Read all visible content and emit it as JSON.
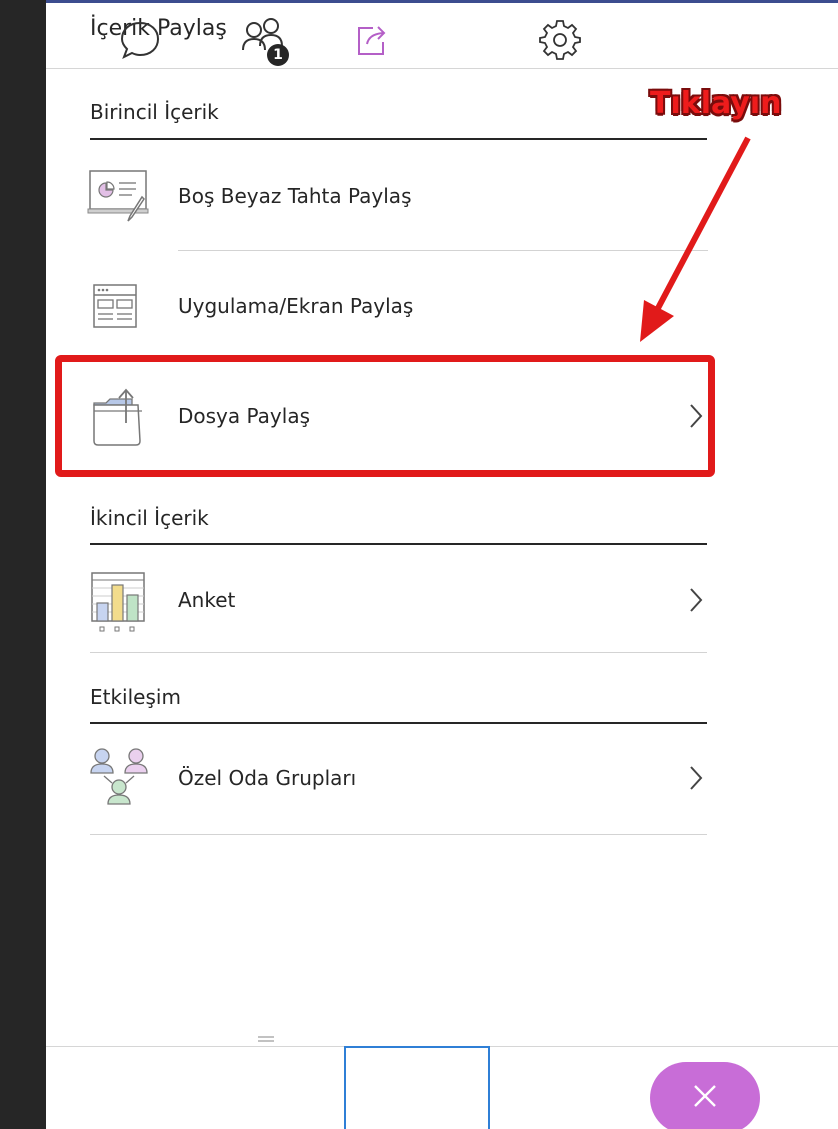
{
  "panel": {
    "title": "İçerik Paylaş"
  },
  "sections": {
    "primary": {
      "header": "Birincil İçerik",
      "items": [
        {
          "label": "Boş Beyaz Tahta Paylaş",
          "icon": "whiteboard-icon"
        },
        {
          "label": "Uygulama/Ekran Paylaş",
          "icon": "application-screen-icon"
        },
        {
          "label": "Dosya Paylaş",
          "icon": "file-share-folder-icon"
        }
      ]
    },
    "secondary": {
      "header": "İkincil İçerik",
      "items": [
        {
          "label": "Anket",
          "icon": "poll-chart-icon"
        }
      ]
    },
    "interaction": {
      "header": "Etkileşim",
      "items": [
        {
          "label": "Özel Oda Grupları",
          "icon": "breakout-groups-icon"
        }
      ]
    }
  },
  "annotation": {
    "text": "Tıklayın",
    "color": "#ee1c1c"
  },
  "bottom_tabs": {
    "chat": {
      "icon": "chat-bubble-icon"
    },
    "attendees": {
      "icon": "attendees-icon",
      "badge": "1"
    },
    "share": {
      "icon": "share-content-icon",
      "active": true
    },
    "settings": {
      "icon": "gear-icon"
    },
    "close": {
      "icon": "close-icon",
      "color": "#c86dd7"
    }
  },
  "colors": {
    "accent": "#c86dd7",
    "active_tab_border": "#2f7fd6",
    "highlight": "#e11a1a",
    "text": "#262626"
  }
}
